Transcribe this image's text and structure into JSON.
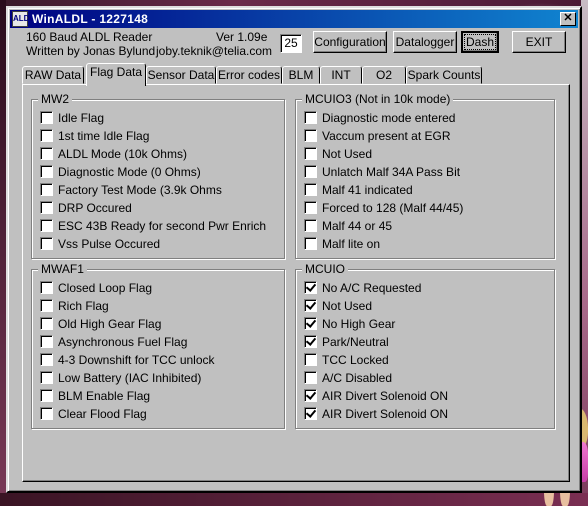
{
  "window": {
    "title": "WinALDL - 1227148",
    "icon_label": "ALDL"
  },
  "header": {
    "line1": "160 Baud ALDL Reader",
    "line2": "Written by Jonas Bylund",
    "version": "Ver 1.09e",
    "email": "joby.teknik@telia.com",
    "counter": "25"
  },
  "buttons": {
    "configuration": "Configuration",
    "datalogger": "Datalogger",
    "dash": "Dash",
    "exit": "EXIT"
  },
  "tabs": [
    "RAW Data",
    "Flag Data",
    "Sensor Data",
    "Error codes",
    "BLM",
    "INT",
    "O2",
    "Spark Counts"
  ],
  "active_tab": "Flag Data",
  "groups": {
    "mw2": {
      "title": "MW2",
      "items": [
        {
          "label": "Idle Flag",
          "checked": false
        },
        {
          "label": "1st time Idle Flag",
          "checked": false
        },
        {
          "label": "ALDL Mode (10k Ohms)",
          "checked": false
        },
        {
          "label": "Diagnostic Mode (0 Ohms)",
          "checked": false
        },
        {
          "label": "Factory Test Mode (3.9k Ohms",
          "checked": false
        },
        {
          "label": "DRP Occured",
          "checked": false
        },
        {
          "label": "ESC 43B Ready for second Pwr Enrich",
          "checked": false
        },
        {
          "label": "Vss Pulse Occured",
          "checked": false
        }
      ]
    },
    "mcuio3": {
      "title": "MCUIO3 (Not in 10k mode)",
      "items": [
        {
          "label": "Diagnostic mode entered",
          "checked": false
        },
        {
          "label": "Vaccum present at EGR",
          "checked": false
        },
        {
          "label": "Not Used",
          "checked": false
        },
        {
          "label": "Unlatch Malf 34A Pass Bit",
          "checked": false
        },
        {
          "label": "Malf 41 indicated",
          "checked": false
        },
        {
          "label": "Forced to 128 (Malf 44/45)",
          "checked": false
        },
        {
          "label": "Malf 44 or 45",
          "checked": false
        },
        {
          "label": "Malf lite on",
          "checked": false
        }
      ]
    },
    "mwaf1": {
      "title": "MWAF1",
      "items": [
        {
          "label": "Closed Loop Flag",
          "checked": false
        },
        {
          "label": "Rich Flag",
          "checked": false
        },
        {
          "label": "Old High Gear Flag",
          "checked": false
        },
        {
          "label": "Asynchronous Fuel Flag",
          "checked": false
        },
        {
          "label": "4-3 Downshift for TCC unlock",
          "checked": false
        },
        {
          "label": "Low Battery (IAC Inhibited)",
          "checked": false
        },
        {
          "label": "BLM Enable Flag",
          "checked": false
        },
        {
          "label": "Clear Flood Flag",
          "checked": false
        }
      ]
    },
    "mcuio": {
      "title": "MCUIO",
      "items": [
        {
          "label": "No A/C Requested",
          "checked": true
        },
        {
          "label": "Not Used",
          "checked": true
        },
        {
          "label": "No High Gear",
          "checked": true
        },
        {
          "label": "Park/Neutral",
          "checked": true
        },
        {
          "label": "TCC Locked",
          "checked": false
        },
        {
          "label": "A/C Disabled",
          "checked": false
        },
        {
          "label": "AIR Divert Solenoid ON",
          "checked": true
        },
        {
          "label": "AIR Divert Solenoid ON",
          "checked": true
        }
      ]
    }
  }
}
